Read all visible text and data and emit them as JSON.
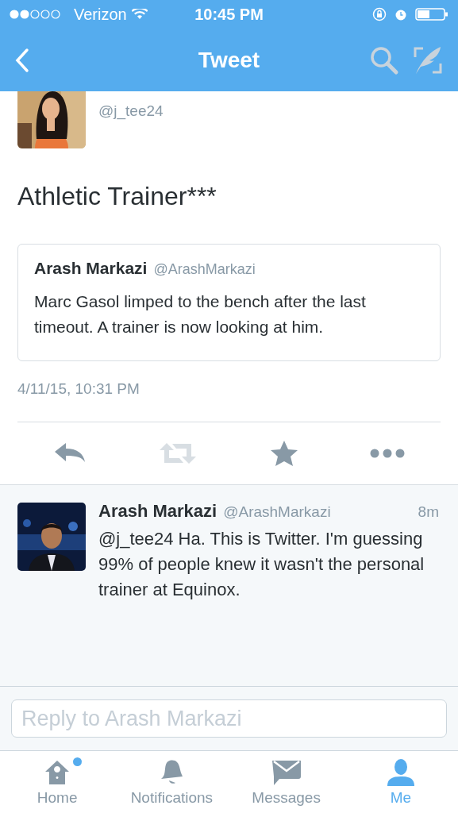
{
  "status_bar": {
    "carrier": "Verizon",
    "time": "10:45 PM"
  },
  "nav": {
    "title": "Tweet"
  },
  "tweet": {
    "handle": "@j_tee24",
    "text": "Athletic Trainer***",
    "quote": {
      "name": "Arash Markazi",
      "handle": "@ArashMarkazi",
      "text": "Marc Gasol limped to the bench after the last timeout. A trainer is now looking at him."
    },
    "date": "4/11/15, 10:31 PM"
  },
  "actions": [
    {
      "kind": "reply",
      "disabled": false
    },
    {
      "kind": "retweet",
      "disabled": true
    },
    {
      "kind": "favorite",
      "disabled": false
    },
    {
      "kind": "more",
      "disabled": false
    }
  ],
  "reply": {
    "name": "Arash Markazi",
    "handle": "@ArashMarkazi",
    "time": "8m",
    "text": "@j_tee24 Ha. This is Twitter. I'm guessing 99% of people knew it wasn't the personal trainer at Equinox."
  },
  "composer": {
    "placeholder": "Reply to Arash Markazi"
  },
  "tabs": [
    {
      "kind": "home",
      "label": "Home",
      "selected": false,
      "badge": true
    },
    {
      "kind": "notifications",
      "label": "Notifications",
      "selected": false,
      "badge": false
    },
    {
      "kind": "messages",
      "label": "Messages",
      "selected": false,
      "badge": false
    },
    {
      "kind": "me",
      "label": "Me",
      "selected": true,
      "badge": false
    }
  ]
}
